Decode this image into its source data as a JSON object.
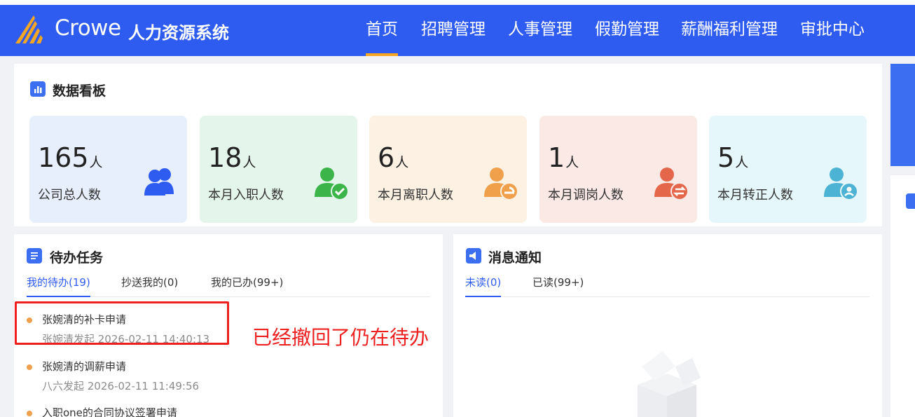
{
  "header": {
    "brand": "Crowe",
    "system_name": "人力资源系统",
    "nav": [
      "首页",
      "招聘管理",
      "人事管理",
      "假勤管理",
      "薪酬福利管理",
      "审批中心"
    ],
    "active_nav": "首页",
    "bg_color": "#2f5cf0",
    "active_color": "#f5a623"
  },
  "dashboard": {
    "title": "数据看板",
    "stats": [
      {
        "value": "165",
        "unit": "人",
        "label": "公司总人数",
        "icon": "people-group-icon",
        "bg": "#e7effd",
        "icon_color": "#2f5cf0"
      },
      {
        "value": "18",
        "unit": "人",
        "label": "本月入职人数",
        "icon": "user-check-icon",
        "bg": "#e4f5ec",
        "icon_color": "#3bb54a"
      },
      {
        "value": "6",
        "unit": "人",
        "label": "本月离职人数",
        "icon": "user-leave-icon",
        "bg": "#fdf1e3",
        "icon_color": "#f0a04b"
      },
      {
        "value": "1",
        "unit": "人",
        "label": "本月调岗人数",
        "icon": "user-transfer-icon",
        "bg": "#fbe9e6",
        "icon_color": "#e5674b"
      },
      {
        "value": "5",
        "unit": "人",
        "label": "本月转正人数",
        "icon": "user-regular-icon",
        "bg": "#e6f7fc",
        "icon_color": "#4cb3d4"
      }
    ]
  },
  "todo": {
    "title": "待办任务",
    "tabs": [
      "我的待办(19)",
      "抄送我的(0)",
      "我的已办(99+)"
    ],
    "items": [
      {
        "title": "张婉清的补卡申请",
        "meta": "张婉清发起   2026-02-11 14:40:13"
      },
      {
        "title": "张婉清的调薪申请",
        "meta": "八六发起   2026-02-11 11:49:56"
      },
      {
        "title": "入职one的合同协议签署申请",
        "meta": ""
      }
    ]
  },
  "notice": {
    "title": "消息通知",
    "tabs": [
      "未读(0)",
      "已读(99+)"
    ]
  },
  "annotation": {
    "text": "已经撤回了仍在待办"
  }
}
